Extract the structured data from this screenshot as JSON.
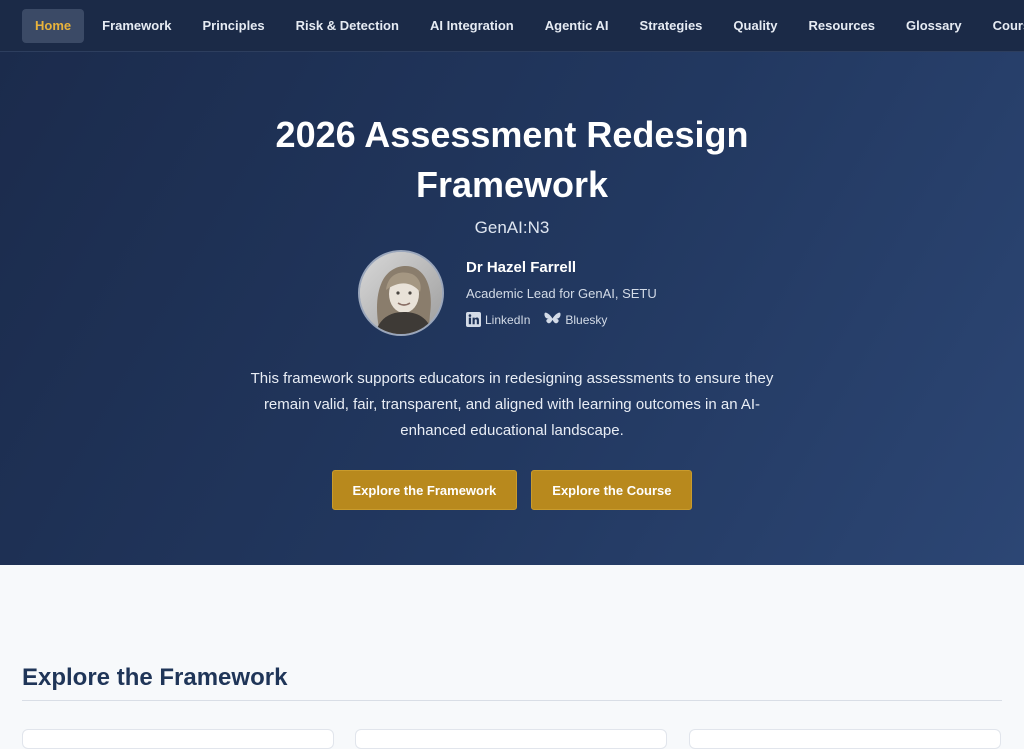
{
  "nav": {
    "items": [
      {
        "label": "Home",
        "active": true
      },
      {
        "label": "Framework"
      },
      {
        "label": "Principles"
      },
      {
        "label": "Risk & Detection"
      },
      {
        "label": "AI Integration"
      },
      {
        "label": "Agentic AI"
      },
      {
        "label": "Strategies"
      },
      {
        "label": "Quality"
      },
      {
        "label": "Resources"
      },
      {
        "label": "Glossary"
      },
      {
        "label": "Course"
      }
    ]
  },
  "hero": {
    "title_line1": "2026 Assessment Redesign",
    "title_line2": "Framework",
    "subtitle": "GenAI:N3",
    "author": {
      "name": "Dr Hazel Farrell",
      "role": "Academic Lead for GenAI, SETU",
      "links": [
        {
          "label": "LinkedIn",
          "icon": "linkedin-icon"
        },
        {
          "label": "Bluesky",
          "icon": "bluesky-icon"
        }
      ]
    },
    "description": "This framework supports educators in redesigning assessments to ensure they remain valid, fair, transparent, and aligned with learning outcomes in an AI-enhanced educational landscape.",
    "buttons": [
      {
        "label": "Explore the Framework"
      },
      {
        "label": "Explore the Course"
      }
    ]
  },
  "section": {
    "title": "Explore the Framework"
  },
  "colors": {
    "nav_bg": "#1b2a47",
    "accent": "#e8b33c",
    "button": "#b8891d",
    "hero_bg": "#223860",
    "heading": "#1f3558"
  }
}
